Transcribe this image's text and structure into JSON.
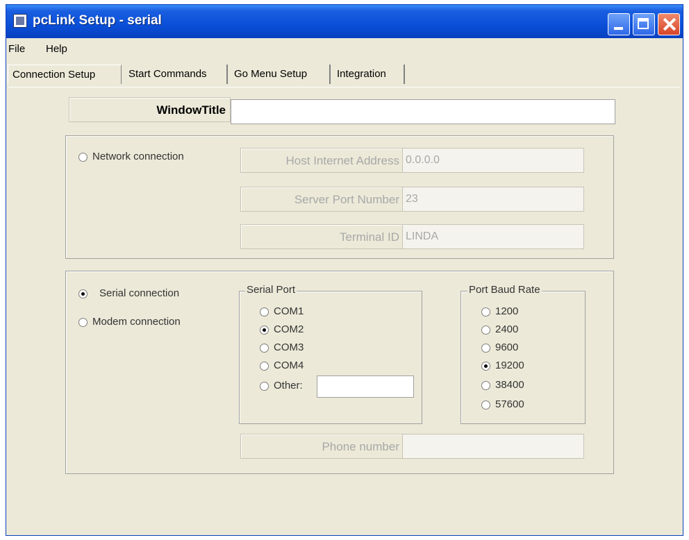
{
  "window": {
    "title": "pcLink Setup - serial"
  },
  "menu": {
    "file": "File",
    "help": "Help"
  },
  "tabs": [
    "Connection Setup",
    "Start Commands",
    "Go Menu Setup",
    "Integration"
  ],
  "window_title_field": {
    "label": "WindowTitle",
    "value": ""
  },
  "network": {
    "radio_label": "Network connection",
    "host_label": "Host Internet Address",
    "host_value": "0.0.0.0",
    "port_label": "Server Port Number",
    "port_value": "23",
    "terminal_label": "Terminal ID",
    "terminal_value": "LINDA"
  },
  "serial": {
    "serial_label": "Serial connection",
    "modem_label": "Modem connection",
    "port_group_title": "Serial Port",
    "ports": [
      "COM1",
      "COM2",
      "COM3",
      "COM4",
      "Other:"
    ],
    "selected_port": "COM2",
    "other_value": "",
    "baud_group_title": "Port Baud Rate",
    "bauds": [
      "1200",
      "2400",
      "9600",
      "19200",
      "38400",
      "57600"
    ],
    "selected_baud": "19200",
    "phone_label": "Phone number",
    "phone_value": ""
  }
}
